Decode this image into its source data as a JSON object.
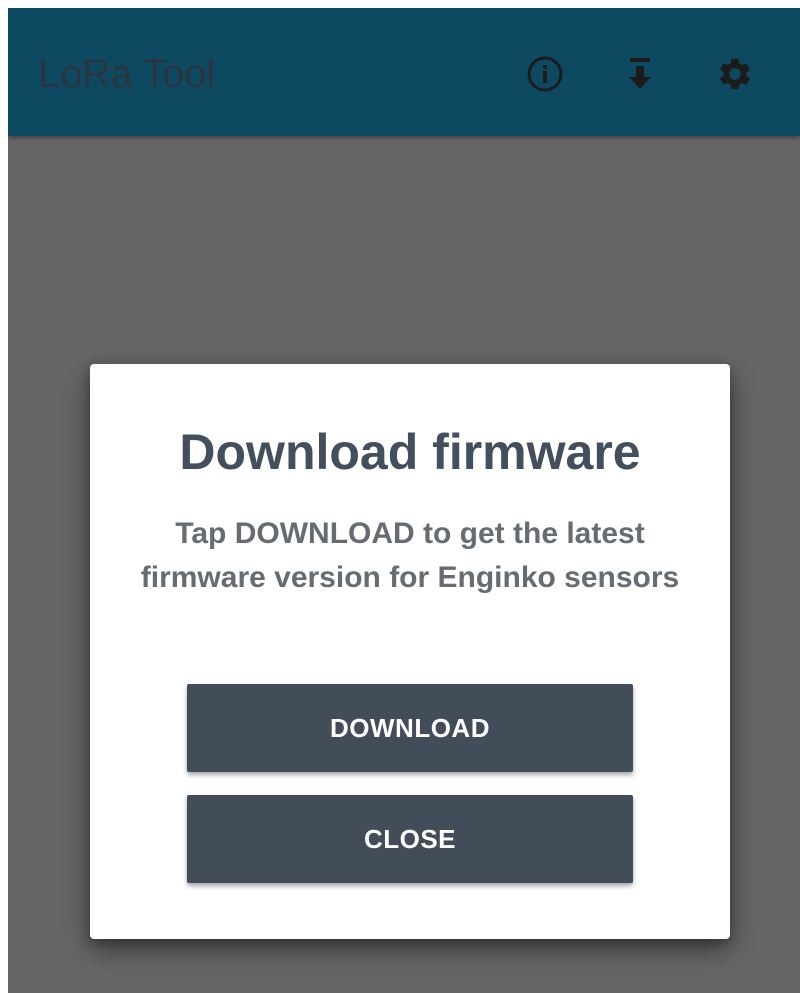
{
  "app_bar": {
    "title": "LoRa Tool",
    "actions": [
      {
        "icon": "info-icon"
      },
      {
        "icon": "download-icon"
      },
      {
        "icon": "gear-icon"
      }
    ]
  },
  "dialog": {
    "title": "Download firmware",
    "message": "Tap DOWNLOAD to get the latest firmware version for Enginko sensors",
    "buttons": {
      "download_label": "DOWNLOAD",
      "close_label": "CLOSE"
    }
  },
  "colors": {
    "app_bar": "#0d4a62",
    "overlay": "#666666",
    "button": "#434d5a",
    "title_text": "#434f5c"
  }
}
